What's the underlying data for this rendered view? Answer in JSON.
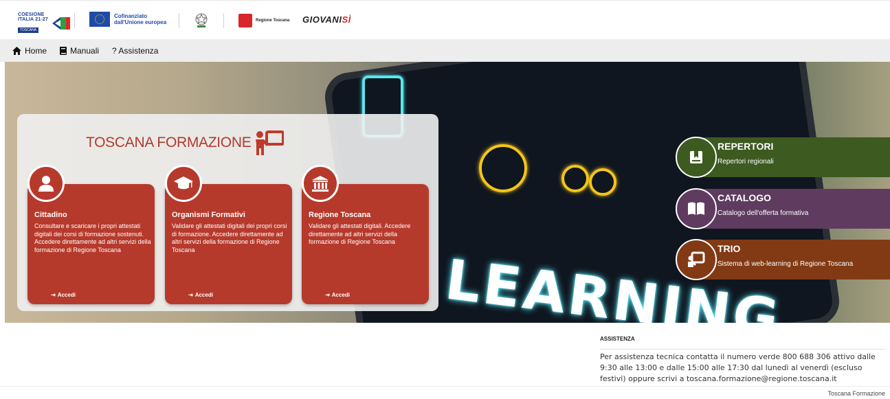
{
  "logos": {
    "coesione_line1": "COESIONE",
    "coesione_line2": "ITALIA 21-27",
    "coesione_region": "TOSCANA",
    "eu_line1": "Cofinanziato",
    "eu_line2": "dall'Unione europea",
    "regione": "Regione Toscana",
    "giovani": "GIOVANI",
    "giovani_si": "SÌ"
  },
  "nav": {
    "home": "Home",
    "manuali": "Manuali",
    "assistenza": "? Assistenza"
  },
  "hero": {
    "background_word": "LEARNING"
  },
  "brand": {
    "title": "TOSCANA FORMAZIONE"
  },
  "cards": [
    {
      "icon": "user-icon",
      "title": "Cittadino",
      "description": "Consultare e scaricare i propri attestati digitali dei corsi di formazione sostenuti. Accedere direttamente ad altri servizi della formazione di Regione Toscana",
      "action": "Accedi"
    },
    {
      "icon": "graduation-cap-icon",
      "title": "Organismi Formativi",
      "description": "Validare gli attestati digitali dei propri corsi di formazione. Accedere direttamente ad altri servizi della formazione di Regione Toscana",
      "action": "Accedi"
    },
    {
      "icon": "institution-icon",
      "title": "Regione Toscana",
      "description": "Validare gli attestati digitali. Accedere direttamente ad altri servizi della formazione di Regione Toscana",
      "action": "Accedi"
    }
  ],
  "services": [
    {
      "icon": "bookmark-book-icon",
      "title": "REPERTORI",
      "subtitle": "Repertori regionali",
      "color": "#3d5a20"
    },
    {
      "icon": "open-book-icon",
      "title": "CATALOGO",
      "subtitle": "Catalogo dell'offerta formativa",
      "color": "#5f3b60"
    },
    {
      "icon": "teacher-board-icon",
      "title": "TRIO",
      "subtitle": "Sistema di web-learning di Regione Toscana",
      "color": "#823a14"
    }
  ],
  "assistance": {
    "heading": "ASSISTENZA",
    "text": "Per assistenza tecnica contatta il numero verde 800 688 306 attivo dalle 9:30 alle 13:00 e dalle 15:00 alle 17:30 dal lunedì al venerdì (escluso festivi) oppure scrivi a toscana.formazione@regione.toscana.it"
  },
  "footer": {
    "text": "Toscana Formazione"
  },
  "colors": {
    "brand_red": "#b63a2c",
    "repertori_green": "#3d5a20",
    "catalogo_purple": "#5f3b60",
    "trio_brown": "#823a14"
  }
}
